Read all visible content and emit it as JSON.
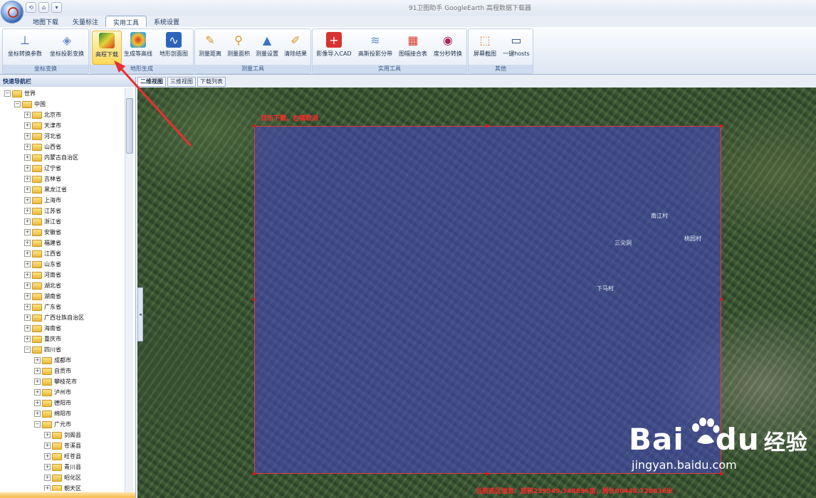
{
  "window": {
    "title": "91卫图助手 GoogleEarth 高程数据下载器"
  },
  "tabs": [
    {
      "label": "地图下载",
      "active": false
    },
    {
      "label": "矢量标注",
      "active": false
    },
    {
      "label": "实用工具",
      "active": true
    },
    {
      "label": "系统设置",
      "active": false
    }
  ],
  "ribbon": {
    "groups": [
      {
        "label": "坐标变换",
        "buttons": [
          {
            "label": "坐标转换参数",
            "icon": "coordinate-axes-icon"
          },
          {
            "label": "坐标投影变换",
            "icon": "projection-icon"
          }
        ]
      },
      {
        "label": "地形生成",
        "buttons": [
          {
            "label": "高程下载",
            "icon": "elevation-map-icon"
          },
          {
            "label": "生成等高线",
            "icon": "contour-icon"
          },
          {
            "label": "地形剖面图",
            "icon": "profile-icon"
          }
        ]
      },
      {
        "label": "测量工具",
        "buttons": [
          {
            "label": "测量距离",
            "icon": "ruler-icon"
          },
          {
            "label": "测量面积",
            "icon": "area-icon"
          },
          {
            "label": "测量设置",
            "icon": "settings-icon"
          },
          {
            "label": "清除结果",
            "icon": "eraser-icon"
          }
        ]
      },
      {
        "label": "实用工具",
        "buttons": [
          {
            "label": "影像导入CAD",
            "icon": "cad-icon"
          },
          {
            "label": "高斯投影分带",
            "icon": "gauss-icon"
          },
          {
            "label": "图幅接合表",
            "icon": "grid-icon"
          },
          {
            "label": "度分秒转换",
            "icon": "dms-icon"
          }
        ]
      },
      {
        "label": "其他",
        "buttons": [
          {
            "label": "屏幕截图",
            "icon": "screenshot-icon"
          },
          {
            "label": "一键hosts",
            "icon": "monitor-icon"
          }
        ]
      }
    ]
  },
  "view_tabs": [
    {
      "label": "二维视图",
      "active": true
    },
    {
      "label": "三维视图",
      "active": false
    },
    {
      "label": "下载列表",
      "active": false
    }
  ],
  "sidebar": {
    "title": "快速导航栏",
    "tree": [
      {
        "label": "世界",
        "level": 0,
        "expanded": true
      },
      {
        "label": "中国",
        "level": 1,
        "expanded": true
      },
      {
        "label": "北京市",
        "level": 2
      },
      {
        "label": "天津市",
        "level": 2
      },
      {
        "label": "河北省",
        "level": 2
      },
      {
        "label": "山西省",
        "level": 2
      },
      {
        "label": "内蒙古自治区",
        "level": 2
      },
      {
        "label": "辽宁省",
        "level": 2
      },
      {
        "label": "吉林省",
        "level": 2
      },
      {
        "label": "黑龙江省",
        "level": 2
      },
      {
        "label": "上海市",
        "level": 2
      },
      {
        "label": "江苏省",
        "level": 2
      },
      {
        "label": "浙江省",
        "level": 2
      },
      {
        "label": "安徽省",
        "level": 2
      },
      {
        "label": "福建省",
        "level": 2
      },
      {
        "label": "江西省",
        "level": 2
      },
      {
        "label": "山东省",
        "level": 2
      },
      {
        "label": "河南省",
        "level": 2
      },
      {
        "label": "湖北省",
        "level": 2
      },
      {
        "label": "湖南省",
        "level": 2
      },
      {
        "label": "广东省",
        "level": 2
      },
      {
        "label": "广西壮族自治区",
        "level": 2
      },
      {
        "label": "海南省",
        "level": 2
      },
      {
        "label": "重庆市",
        "level": 2
      },
      {
        "label": "四川省",
        "level": 2,
        "expanded": true
      },
      {
        "label": "成都市",
        "level": 3
      },
      {
        "label": "自贡市",
        "level": 3
      },
      {
        "label": "攀枝花市",
        "level": 3
      },
      {
        "label": "泸州市",
        "level": 3
      },
      {
        "label": "德阳市",
        "level": 3
      },
      {
        "label": "绵阳市",
        "level": 3
      },
      {
        "label": "广元市",
        "level": 3,
        "expanded": true
      },
      {
        "label": "剑阁县",
        "level": 4
      },
      {
        "label": "苍溪县",
        "level": 4
      },
      {
        "label": "旺苍县",
        "level": 4
      },
      {
        "label": "青川县",
        "level": 4
      },
      {
        "label": "昭化区",
        "level": 4
      },
      {
        "label": "朝天区",
        "level": 4
      }
    ]
  },
  "map": {
    "hint": "双击下载，右键取消",
    "places": [
      "南江村",
      "三尖洞",
      "桃园村",
      "下马村"
    ],
    "status": "当前选区信息：面积239549.348896亩，周长90448.728636米",
    "selection_color": "#4646c8",
    "border_color": "#e23a3a"
  },
  "watermark": {
    "brand": "Bai",
    "brand2": "du",
    "cn": "经验",
    "url": "jingyan.baidu.com"
  }
}
